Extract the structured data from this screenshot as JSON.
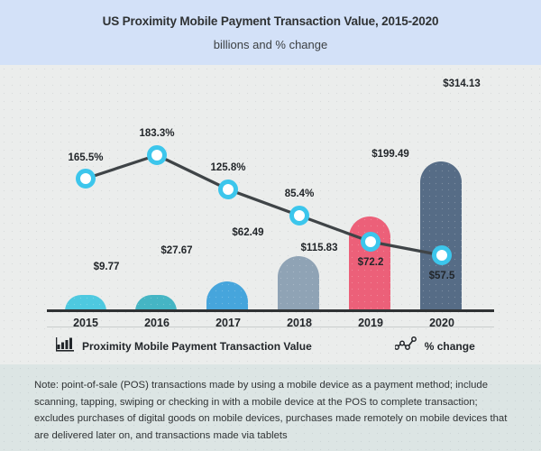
{
  "header": {
    "title": "US Proximity Mobile Payment Transaction Value, 2015-2020",
    "subtitle": "billions and % change"
  },
  "legend": {
    "series1_label": "Proximity Mobile Payment Transaction Value",
    "series1_icon": "bar-chart-icon",
    "series2_label": "% change",
    "series2_icon": "line-chart-icon"
  },
  "footer": {
    "note": "Note: point-of-sale (POS) transactions made by using a mobile device as a payment method; include scanning, tapping, swiping or checking in with a mobile device at the POS to complete transaction; excludes purchases of digital goods on mobile devices, purchases made remotely on mobile devices that are delivered later on, and transactions made via tablets"
  },
  "colors": {
    "header_bg": "#d3e1f8",
    "plot_bg": "#ebedec",
    "footer_bg": "#dce5e4",
    "axis": "#2f3234",
    "line": "#3f4447",
    "marker_ring": "#3cc6ec",
    "marker_fill": "#ffffff",
    "text": "#22262a"
  },
  "chart_data": {
    "type": "bar",
    "title": "US Proximity Mobile Payment Transaction Value, 2015-2020",
    "subtitle": "billions and % change",
    "xlabel": "",
    "ylabel": "",
    "grid": false,
    "legend_position": "bottom",
    "categories": [
      "2015",
      "2016",
      "2017",
      "2018",
      "2019",
      "2020"
    ],
    "series": [
      {
        "name": "Proximity Mobile Payment Transaction Value",
        "type": "bar",
        "unit": "billions USD",
        "values": [
          9.77,
          27.67,
          62.49,
          115.83,
          199.49,
          314.13
        ],
        "labels": [
          "$9.77",
          "$27.67",
          "$62.49",
          "$115.83",
          "$199.49",
          "$314.13"
        ],
        "colors": [
          "#4ec9e0",
          "#45b5c4",
          "#46a5dc",
          "#8fa3b5",
          "#ec6079",
          "#566c86"
        ]
      },
      {
        "name": "% change",
        "type": "line",
        "unit": "percent",
        "values": [
          165.5,
          183.3,
          125.8,
          85.4,
          72.2,
          57.5
        ],
        "labels": [
          "165.5%",
          "183.3%",
          "125.8%",
          "85.4%",
          "$72.2",
          "$57.5"
        ],
        "line_color": "#3f4447",
        "marker_color": "#3cc6ec"
      }
    ]
  }
}
